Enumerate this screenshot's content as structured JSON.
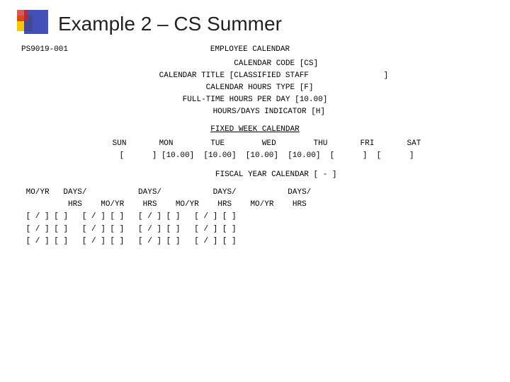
{
  "header": {
    "title": "Example 2 – CS Summer"
  },
  "program": {
    "id": "PS9019-001",
    "screen_title": "EMPLOYEE CALENDAR"
  },
  "calendar": {
    "code_label": "CALENDAR CODE",
    "code_value": "[CS]",
    "title_label": "CALENDAR TITLE",
    "title_value": "[CLASSIFIED STAFF                ]",
    "hours_type_label": "CALENDAR HOURS TYPE",
    "hours_type_value": "[F]",
    "hours_per_day_label": "FULL-TIME HOURS PER DAY",
    "hours_per_day_value": "[10.00]",
    "hours_days_label": "HOURS/DAYS INDICATOR",
    "hours_days_value": "[H]"
  },
  "fixed_week": {
    "section_title": "FIXED WEEK CALENDAR",
    "headers": [
      "SUN",
      "MON",
      "TUE",
      "WED",
      "THU",
      "FRI",
      "SAT"
    ],
    "values": [
      "[      ]",
      "[10.00]",
      "[10.00]",
      "[10.00]",
      "[10.00]",
      "[      ]",
      "[      ]"
    ]
  },
  "fiscal_year": {
    "label": "FISCAL YEAR CALENDAR",
    "value": "[ - ]"
  },
  "mo_yr_table": {
    "col_headers": [
      "MO/YR",
      "DAYS/\nHRS",
      "MO/YR",
      "DAYS/\nHRS",
      "MO/YR",
      "DAYS/\nHRS",
      "MO/YR",
      "DAYS/\nHRS"
    ],
    "rows": [
      [
        "[ / ]",
        "[ ]",
        "[ / ]",
        "[ ]",
        "[ / ]",
        "[ ]",
        "[ / ]",
        "[ ]"
      ],
      [
        "[ / ]",
        "[ ]",
        "[ / ]",
        "[ ]",
        "[ / ]",
        "[ ]",
        "[ / ]",
        "[ ]"
      ],
      [
        "[ / ]",
        "[ ]",
        "[ / ]",
        "[ ]",
        "[ / ]",
        "[ ]",
        "[ / ]",
        "[ ]"
      ]
    ]
  }
}
